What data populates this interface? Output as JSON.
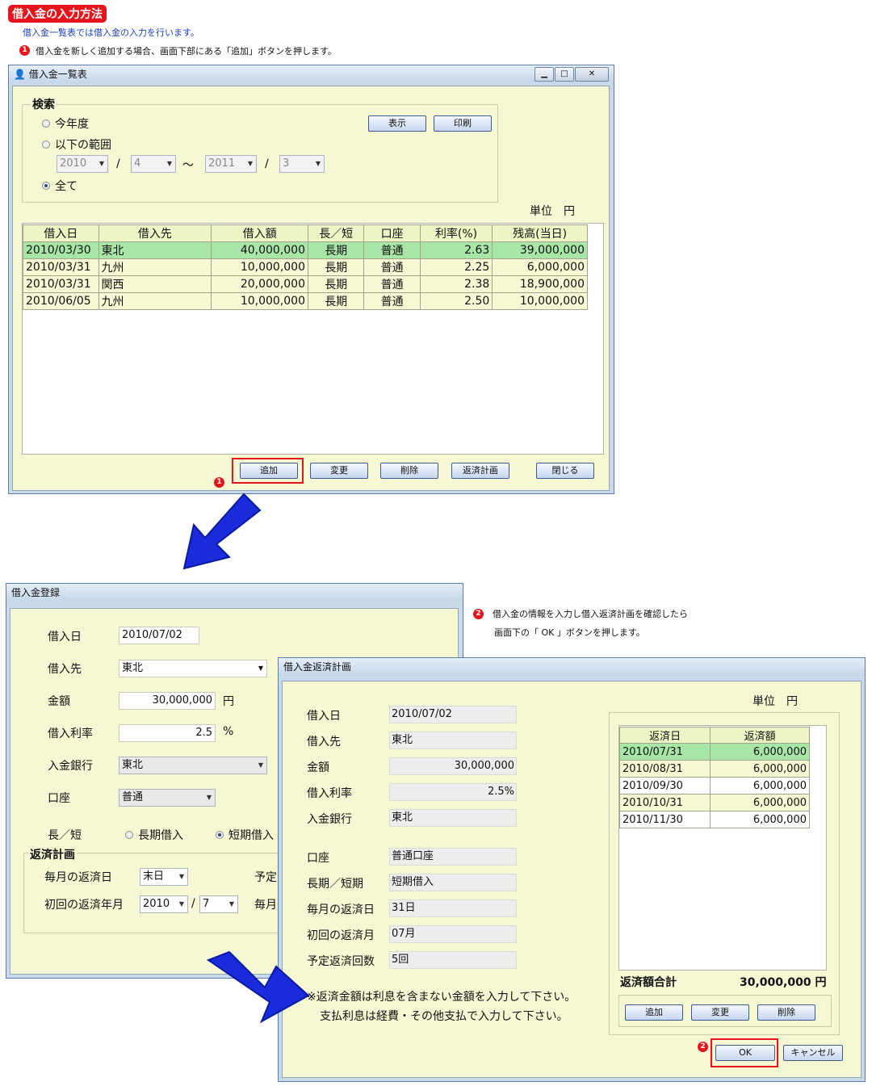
{
  "header": {
    "title": "借入金の入力方法",
    "subtitle": "借入金一覧表では借入金の入力を行います。",
    "step1": "借入金を新しく追加する場合、画面下部にある「追加」ボタンを押します。",
    "step2_line1": "借入金の情報を入力し借入返済計画を確認したら",
    "step2_line2": "画面下の「 OK 」ボタンを押します。",
    "num1": "1",
    "num2": "2"
  },
  "list_window": {
    "title": "借入金一覧表",
    "search_label": "検索",
    "radio_this_year": "今年度",
    "radio_range": "以下の範囲",
    "radio_all": "全て",
    "range_from_year": "2010",
    "range_from_month": "4",
    "range_to_year": "2011",
    "range_to_month": "3",
    "slash": "/",
    "tilde": "〜",
    "show_button": "表示",
    "print_button": "印刷",
    "unit": "単位　円",
    "columns": [
      "借入日",
      "借入先",
      "借入額",
      "長／短",
      "口座",
      "利率(%)",
      "残高(当日)"
    ],
    "rows": [
      {
        "date": "2010/03/30",
        "lender": "東北",
        "amount": "40,000,000",
        "term": "長期",
        "account": "普通",
        "rate": "2.63",
        "balance": "39,000,000"
      },
      {
        "date": "2010/03/31",
        "lender": "九州",
        "amount": "10,000,000",
        "term": "長期",
        "account": "普通",
        "rate": "2.25",
        "balance": "6,000,000"
      },
      {
        "date": "2010/03/31",
        "lender": "関西",
        "amount": "20,000,000",
        "term": "長期",
        "account": "普通",
        "rate": "2.38",
        "balance": "18,900,000"
      },
      {
        "date": "2010/06/05",
        "lender": "九州",
        "amount": "10,000,000",
        "term": "長期",
        "account": "普通",
        "rate": "2.50",
        "balance": "10,000,000"
      }
    ],
    "add_button": "追加",
    "edit_button": "変更",
    "delete_button": "削除",
    "plan_button": "返済計画",
    "close_button": "閉じる"
  },
  "reg_window": {
    "title": "借入金登録",
    "date_label": "借入日",
    "date_value": "2010/07/02",
    "lender_label": "借入先",
    "lender_value": "東北",
    "amount_label": "金額",
    "amount_value": "30,000,000",
    "amount_unit": "円",
    "rate_label": "借入利率",
    "rate_value": "2.5",
    "rate_unit": "%",
    "bank_label": "入金銀行",
    "bank_value": "東北",
    "account_label": "口座",
    "account_value": "普通",
    "term_label": "長／短",
    "term_long": "長期借入",
    "term_short": "短期借入",
    "plan_group": "返済計画",
    "monthly_day_label": "毎月の返済日",
    "monthly_day_value": "末日",
    "first_label": "初回の返済年月",
    "first_year": "2010",
    "first_month": "7",
    "slash": "/",
    "cut1": "予定",
    "cut2": "毎月"
  },
  "plan_window": {
    "title": "借入金返済計画",
    "unit": "単位　円",
    "labels": [
      "借入日",
      "借入先",
      "金額",
      "借入利率",
      "入金銀行",
      "口座",
      "長期／短期",
      "毎月の返済日",
      "初回の返済月",
      "予定返済回数"
    ],
    "values": [
      "2010/07/02",
      "東北",
      "30,000,000",
      "2.5%",
      "東北",
      "普通口座",
      "短期借入",
      "31日",
      "07月",
      "5回"
    ],
    "columns": [
      "返済日",
      "返済額"
    ],
    "rows": [
      {
        "date": "2010/07/31",
        "amount": "6,000,000"
      },
      {
        "date": "2010/08/31",
        "amount": "6,000,000"
      },
      {
        "date": "2010/09/30",
        "amount": "6,000,000"
      },
      {
        "date": "2010/10/31",
        "amount": "6,000,000"
      },
      {
        "date": "2010/11/30",
        "amount": "6,000,000"
      }
    ],
    "total_label": "返済額合計",
    "total_value": "30,000,000 円",
    "add_button": "追加",
    "edit_button": "変更",
    "delete_button": "削除",
    "note_line1": "※返済金額は利息を含まない金額を入力して下さい。",
    "note_line2": "支払利息は経費・その他支払で入力して下さい。",
    "ok_button": "OK",
    "cancel_button": "キャンセル"
  }
}
